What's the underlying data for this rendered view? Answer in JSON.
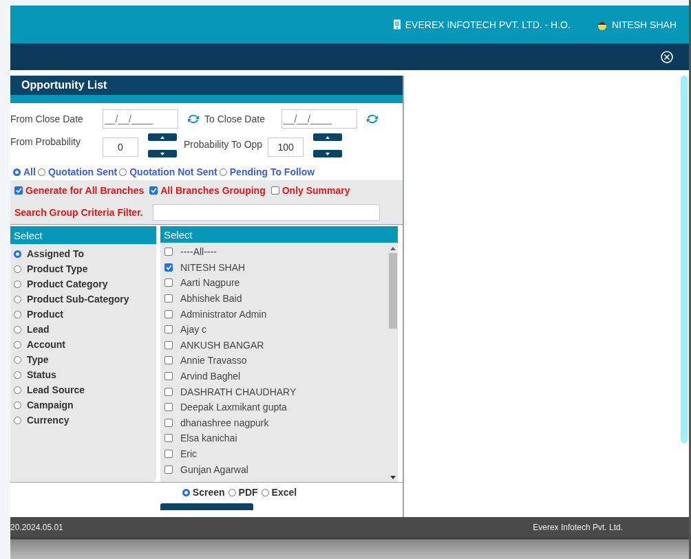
{
  "header": {
    "company": "EVEREX INFOTECH PVT. LTD. - H.O.",
    "user": "NITESH SHAH"
  },
  "panel": {
    "title": "Opportunity List",
    "dates": [
      {
        "label": "From Close Date",
        "placeholder": "__/__/____"
      },
      {
        "label": "To Close Date",
        "placeholder": "__/__/____"
      }
    ],
    "probabilities": [
      {
        "label": "From Probability",
        "value": "0"
      },
      {
        "label": "Probability To Opp",
        "value": "100"
      }
    ],
    "quotation_filter": [
      {
        "label": "All",
        "selected": true
      },
      {
        "label": "Quotation Sent",
        "selected": false
      },
      {
        "label": "Quotation Not Sent",
        "selected": false
      },
      {
        "label": "Pending To Follow",
        "selected": false
      }
    ],
    "options": [
      {
        "label": "Generate for All Branches",
        "checked": true
      },
      {
        "label": "All Branches Grouping",
        "checked": true
      },
      {
        "label": "Only Summary",
        "checked": false
      }
    ],
    "search": {
      "label": "Search Group Criteria Filter."
    },
    "group_by": {
      "header": "Select",
      "items": [
        {
          "label": "Assigned To",
          "selected": true
        },
        {
          "label": "Product Type",
          "selected": false
        },
        {
          "label": "Product Category",
          "selected": false
        },
        {
          "label": "Product Sub-Category",
          "selected": false
        },
        {
          "label": "Product",
          "selected": false
        },
        {
          "label": "Lead",
          "selected": false
        },
        {
          "label": "Account",
          "selected": false
        },
        {
          "label": "Type",
          "selected": false
        },
        {
          "label": "Status",
          "selected": false
        },
        {
          "label": "Lead Source",
          "selected": false
        },
        {
          "label": "Campaign",
          "selected": false
        },
        {
          "label": "Currency",
          "selected": false
        }
      ]
    },
    "values": {
      "header": "Select",
      "items": [
        {
          "label": "----All----",
          "checked": false
        },
        {
          "label": "NITESH SHAH",
          "checked": true
        },
        {
          "label": "Aarti Nagpure",
          "checked": false
        },
        {
          "label": "Abhishek Baid",
          "checked": false
        },
        {
          "label": "Administrator Admin",
          "checked": false
        },
        {
          "label": "Ajay c",
          "checked": false
        },
        {
          "label": "ANKUSH BANGAR",
          "checked": false
        },
        {
          "label": "Annie Travasso",
          "checked": false
        },
        {
          "label": "Arvind Baghel",
          "checked": false
        },
        {
          "label": "DASHRATH CHAUDHARY",
          "checked": false
        },
        {
          "label": "Deepak Laxmikant gupta",
          "checked": false
        },
        {
          "label": "dhanashree nagpurk",
          "checked": false
        },
        {
          "label": "Elsa kanichai",
          "checked": false
        },
        {
          "label": "Eric",
          "checked": false
        },
        {
          "label": "Gunjan Agarwal",
          "checked": false
        }
      ]
    },
    "output": [
      {
        "label": "Screen",
        "selected": true
      },
      {
        "label": "PDF",
        "selected": false
      },
      {
        "label": "Excel",
        "selected": false
      }
    ]
  },
  "footer": {
    "version": "20.2024.05.01",
    "company": "Everex Infotech Pvt. Ltd."
  }
}
